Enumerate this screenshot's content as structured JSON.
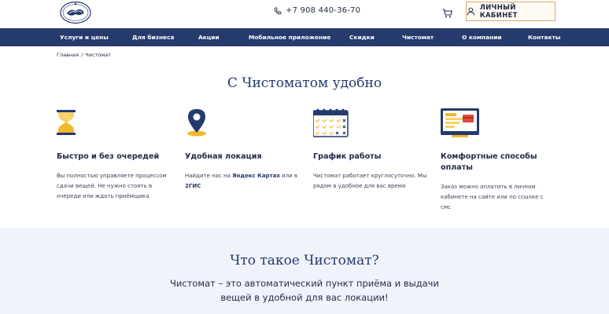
{
  "header": {
    "phone": "+7 908 440-36-70",
    "account_label": "ЛИЧНЫЙ КАБИНЕТ",
    "colors": {
      "nav_bg": "#253a6d",
      "accent_border": "#e0a86a"
    }
  },
  "nav": {
    "items": [
      "Услуги и цены",
      "Для бизнеса",
      "Акции",
      "Мобильное приложение",
      "Скидки",
      "Чистомат",
      "О компании",
      "Контакты"
    ]
  },
  "breadcrumb": {
    "home": "Главная",
    "separator": "/",
    "current": "Чистомат"
  },
  "section1": {
    "title": "С Чистоматом удобно",
    "features": [
      {
        "icon": "hourglass-icon",
        "heading": "Быстро и без очередей",
        "desc_lines": [
          "Вы полностью управляете процессом",
          "сдачи вещей. Не нужно стоять в",
          "очереди или ждать приёмщика"
        ]
      },
      {
        "icon": "location-pin-icon",
        "heading": "Удобная локация",
        "desc_prefix": "Найдите нас на ",
        "desc_link1": "Яндекс Картах",
        "desc_middle": " или в",
        "desc_link2": "2ГИС"
      },
      {
        "icon": "calendar-icon",
        "heading": "График работы",
        "desc_lines": [
          "Чистомат работает круглосуточно. Мы",
          "рядом в удобное для вас время"
        ]
      },
      {
        "icon": "payment-screen-icon",
        "heading_lines": [
          "Комфортные способы",
          "оплаты"
        ],
        "desc_lines": [
          "Заказ можно оплатить в личном",
          "кабинете на сайте или по ссылке с смс"
        ]
      }
    ]
  },
  "section2": {
    "title": "Что такое Чистомат?",
    "subtitle_lines": [
      "Чистомат – это автоматический пункт приёма и выдачи",
      "вещей в удобной для вас локации!"
    ]
  }
}
